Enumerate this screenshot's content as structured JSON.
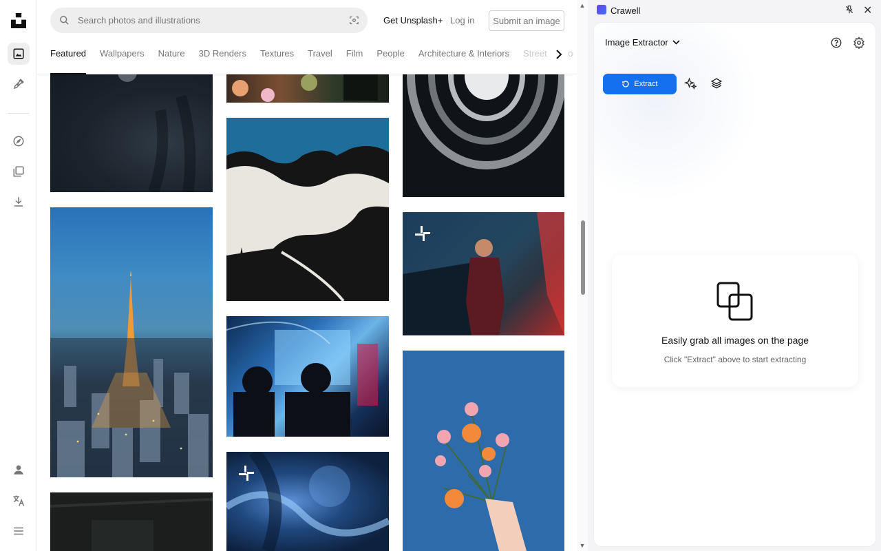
{
  "rail": {
    "items": [
      "unsplash-logo",
      "photos-icon",
      "illustrations-icon",
      "explore-icon",
      "collections-icon",
      "download-icon",
      "user-icon",
      "translate-icon",
      "menu-icon"
    ]
  },
  "header": {
    "search_placeholder": "Search photos and illustrations",
    "get_plus": "Get Unsplash+",
    "login": "Log in",
    "submit": "Submit an image"
  },
  "tabs": [
    {
      "label": "Featured",
      "active": true
    },
    {
      "label": "Wallpapers"
    },
    {
      "label": "Nature"
    },
    {
      "label": "3D Renders"
    },
    {
      "label": "Textures"
    },
    {
      "label": "Travel"
    },
    {
      "label": "Film"
    },
    {
      "label": "People"
    },
    {
      "label": "Architecture & Interiors"
    },
    {
      "label": "Street Photography"
    }
  ],
  "extension": {
    "app_name": "Crawell",
    "mode": "Image Extractor",
    "extract_label": "Extract",
    "empty_title": "Easily grab all images on the page",
    "empty_subtitle": "Click \"Extract\" above to start extracting",
    "accent": "#1570EF"
  }
}
